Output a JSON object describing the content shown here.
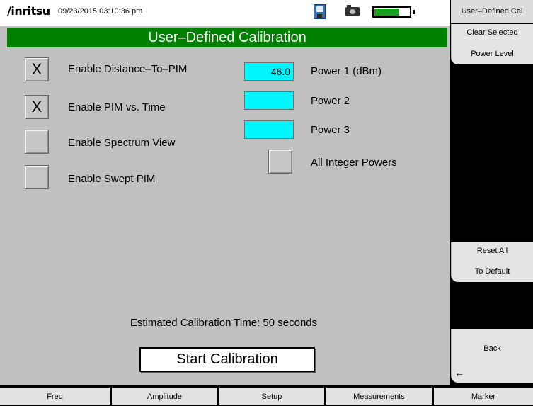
{
  "status_bar": {
    "logo": "/inritsu",
    "datetime": "09/23/2015 03:10:36 pm",
    "battery_level": 0.72,
    "icons": [
      "save-icon",
      "camera-icon",
      "battery-icon"
    ]
  },
  "main": {
    "title": "User–Defined Calibration",
    "options": [
      {
        "label": "Enable Distance–To–PIM",
        "checked": true,
        "mark": "X"
      },
      {
        "label": "Enable PIM vs. Time",
        "checked": true,
        "mark": "X"
      },
      {
        "label": "Enable Spectrum View",
        "checked": false,
        "mark": ""
      },
      {
        "label": "Enable Swept PIM",
        "checked": false,
        "mark": ""
      }
    ],
    "powers": [
      {
        "label": "Power 1 (dBm)",
        "value": "46.0"
      },
      {
        "label": "Power 2",
        "value": ""
      },
      {
        "label": "Power 3",
        "value": ""
      }
    ],
    "all_integer_powers": {
      "label": "All Integer Powers",
      "checked": false
    },
    "estimate": "Estimated Calibration Time: 50 seconds",
    "start_button": "Start Calibration"
  },
  "sidebar": {
    "title": "User–Defined Cal",
    "keys": [
      {
        "line1": "Clear Selected",
        "line2": "Power Level"
      },
      {
        "line1": "Reset All",
        "line2": "To Default"
      },
      {
        "line1": "Back",
        "line2": ""
      }
    ],
    "back_arrow": "←"
  },
  "bottom_menu": [
    "Freq",
    "Amplitude",
    "Setup",
    "Measurements",
    "Marker"
  ],
  "colors": {
    "title_bar": "#008000",
    "panel": "#c0c0c0",
    "input_fill": "#00f5ff",
    "battery": "#14a01e"
  }
}
